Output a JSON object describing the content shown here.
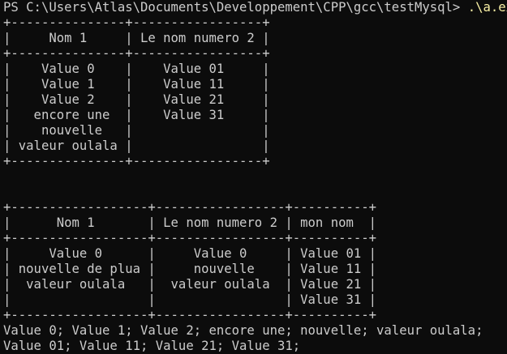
{
  "terminal": {
    "prompt": "PS C:\\Users\\Atlas\\Documents\\Developpement\\CPP\\gcc\\testMysql> ",
    "command": ".\\a.exe",
    "output": [
      "+---------------+-----------------+",
      "|     Nom 1     | Le nom numero 2 |",
      "+---------------+-----------------+",
      "|    Value 0    |    Value 01     |",
      "|    Value 1    |    Value 11     |",
      "|    Value 2    |    Value 21     |",
      "|   encore une  |    Value 31     |",
      "|    nouvelle   |                 |",
      "| valeur oulala |                 |",
      "+---------------+-----------------+",
      "",
      "",
      "+------------------+-----------------+----------+",
      "|      Nom 1       | Le nom numero 2 | mon nom  |",
      "+------------------+-----------------+----------+",
      "|     Value 0      |     Value 0     | Value 01 |",
      "| nouvelle de plua |     nouvelle    | Value 11 |",
      "|  valeur oulala   |  valeur oulala  | Value 21 |",
      "|                  |                 | Value 31 |",
      "+------------------+-----------------+----------+",
      "Value 0; Value 1; Value 2; encore une; nouvelle; valeur oulala;",
      "Value 01; Value 11; Value 21; Value 31;"
    ]
  }
}
